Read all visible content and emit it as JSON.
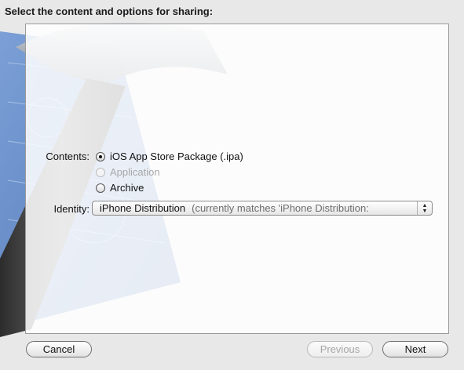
{
  "heading": "Select the content and options for sharing:",
  "contents": {
    "label": "Contents:",
    "options": [
      {
        "label": "iOS App Store Package (.ipa)",
        "selected": true,
        "enabled": true
      },
      {
        "label": "Application",
        "selected": false,
        "enabled": false
      },
      {
        "label": "Archive",
        "selected": false,
        "enabled": true
      }
    ]
  },
  "identity": {
    "label": "Identity:",
    "value": "iPhone Distribution",
    "detail": "(currently matches 'iPhone Distribution:"
  },
  "buttons": {
    "cancel": "Cancel",
    "previous": "Previous",
    "next": "Next"
  },
  "background_art": "xcode-hammer-blueprint",
  "colors": {
    "blueprint": "#5b86c8",
    "hammer_head": "#9aa0a8",
    "panel_border": "#9a9a9a"
  }
}
